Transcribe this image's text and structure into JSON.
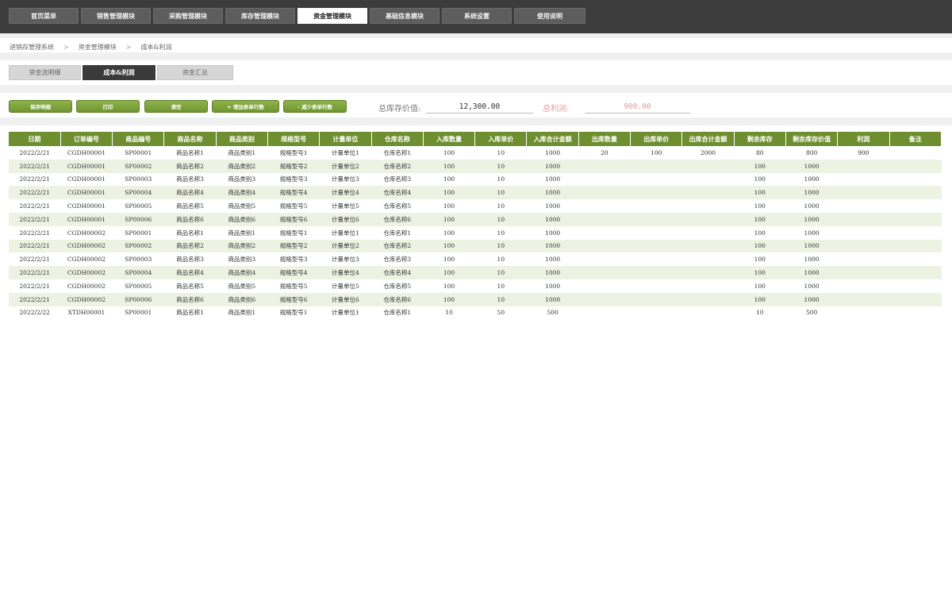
{
  "nav": [
    "首页菜单",
    "销售管理模块",
    "采购管理模块",
    "库存管理模块",
    "资金管理模块",
    "基础信息模块",
    "系统设置",
    "使用说明"
  ],
  "nav_active_index": 4,
  "breadcrumb": [
    "进销存管理系统",
    "资金管理模块",
    "成本&利润"
  ],
  "breadcrumb_sep": ">",
  "subtabs": [
    "资金流明细",
    "成本&利润",
    "资金汇总"
  ],
  "subtab_active_index": 1,
  "actions": {
    "save": "保存明细",
    "print": "打印",
    "clear": "清空",
    "add_rows": "+ 增加表单行数",
    "remove_rows": "- 减少表单行数"
  },
  "summary": {
    "stock_value_label": "总库存价值:",
    "stock_value": "12,300.00",
    "profit_label": "总利润:",
    "profit": "900.00"
  },
  "table": {
    "columns": [
      "日期",
      "订单编号",
      "商品编号",
      "商品名称",
      "商品类别",
      "规格型号",
      "计量单位",
      "仓库名称",
      "入库数量",
      "入库单价",
      "入库合计金额",
      "出库数量",
      "出库单价",
      "出库合计金额",
      "剩余库存",
      "剩余库存价值",
      "利润",
      "备注"
    ],
    "rows": [
      [
        "2022/2/21",
        "CGDH00001",
        "SP00001",
        "商品名称1",
        "商品类别1",
        "规格型号1",
        "计量单位1",
        "仓库名称1",
        "100",
        "10",
        "1000",
        "20",
        "100",
        "2000",
        "80",
        "800",
        "900",
        ""
      ],
      [
        "2022/2/21",
        "CGDH00001",
        "SP00002",
        "商品名称2",
        "商品类别2",
        "规格型号2",
        "计量单位2",
        "仓库名称2",
        "100",
        "10",
        "1000",
        "",
        "",
        "",
        "100",
        "1000",
        "",
        ""
      ],
      [
        "2022/2/21",
        "CGDH00001",
        "SP00003",
        "商品名称3",
        "商品类别3",
        "规格型号3",
        "计量单位3",
        "仓库名称3",
        "100",
        "10",
        "1000",
        "",
        "",
        "",
        "100",
        "1000",
        "",
        ""
      ],
      [
        "2022/2/21",
        "CGDH00001",
        "SP00004",
        "商品名称4",
        "商品类别4",
        "规格型号4",
        "计量单位4",
        "仓库名称4",
        "100",
        "10",
        "1000",
        "",
        "",
        "",
        "100",
        "1000",
        "",
        ""
      ],
      [
        "2022/2/21",
        "CGDH00001",
        "SP00005",
        "商品名称5",
        "商品类别5",
        "规格型号5",
        "计量单位5",
        "仓库名称5",
        "100",
        "10",
        "1000",
        "",
        "",
        "",
        "100",
        "1000",
        "",
        ""
      ],
      [
        "2022/2/21",
        "CGDH00001",
        "SP00006",
        "商品名称6",
        "商品类别6",
        "规格型号6",
        "计量单位6",
        "仓库名称6",
        "100",
        "10",
        "1000",
        "",
        "",
        "",
        "100",
        "1000",
        "",
        ""
      ],
      [
        "2022/2/21",
        "CGDH00002",
        "SP00001",
        "商品名称1",
        "商品类别1",
        "规格型号1",
        "计量单位1",
        "仓库名称1",
        "100",
        "10",
        "1000",
        "",
        "",
        "",
        "100",
        "1000",
        "",
        ""
      ],
      [
        "2022/2/21",
        "CGDH00002",
        "SP00002",
        "商品名称2",
        "商品类别2",
        "规格型号2",
        "计量单位2",
        "仓库名称2",
        "100",
        "10",
        "1000",
        "",
        "",
        "",
        "100",
        "1000",
        "",
        ""
      ],
      [
        "2022/2/21",
        "CGDH00002",
        "SP00003",
        "商品名称3",
        "商品类别3",
        "规格型号3",
        "计量单位3",
        "仓库名称3",
        "100",
        "10",
        "1000",
        "",
        "",
        "",
        "100",
        "1000",
        "",
        ""
      ],
      [
        "2022/2/21",
        "CGDH00002",
        "SP00004",
        "商品名称4",
        "商品类别4",
        "规格型号4",
        "计量单位4",
        "仓库名称4",
        "100",
        "10",
        "1000",
        "",
        "",
        "",
        "100",
        "1000",
        "",
        ""
      ],
      [
        "2022/2/21",
        "CGDH00002",
        "SP00005",
        "商品名称5",
        "商品类别5",
        "规格型号5",
        "计量单位5",
        "仓库名称5",
        "100",
        "10",
        "1000",
        "",
        "",
        "",
        "100",
        "1000",
        "",
        ""
      ],
      [
        "2022/2/21",
        "CGDH00002",
        "SP00006",
        "商品名称6",
        "商品类别6",
        "规格型号6",
        "计量单位6",
        "仓库名称6",
        "100",
        "10",
        "1000",
        "",
        "",
        "",
        "100",
        "1000",
        "",
        ""
      ],
      [
        "2022/2/22",
        "XTDH00001",
        "SP00001",
        "商品名称1",
        "商品类别1",
        "规格型号1",
        "计量单位1",
        "仓库名称1",
        "10",
        "50",
        "500",
        "",
        "",
        "",
        "10",
        "500",
        "",
        ""
      ]
    ]
  }
}
